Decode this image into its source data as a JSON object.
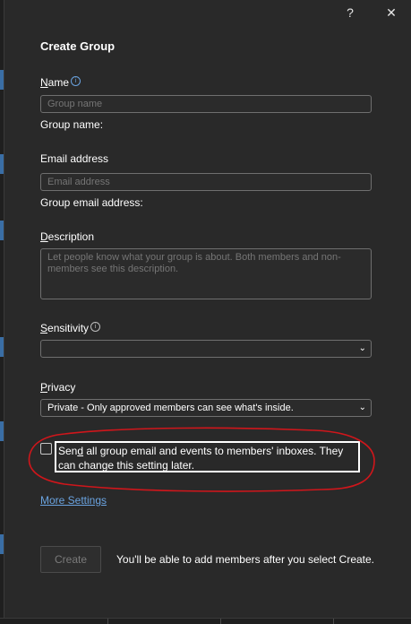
{
  "titlebar": {
    "help": "?",
    "close": "✕"
  },
  "dialog": {
    "title": "Create Group"
  },
  "name": {
    "label_first": "N",
    "label_rest": "ame",
    "placeholder": "Group name",
    "helper": "Group name:"
  },
  "email": {
    "label": "Email address",
    "placeholder": "Email address",
    "helper": "Group email address:"
  },
  "description": {
    "label_first": "D",
    "label_rest": "escription",
    "placeholder": "Let people know what your group is about. Both members and non-members see this description."
  },
  "sensitivity": {
    "label_first": "S",
    "label_rest": "ensitivity",
    "value": ""
  },
  "privacy": {
    "label_first": "P",
    "label_rest": "rivacy",
    "value": "Private - Only approved members can see what's inside."
  },
  "subscribe": {
    "checked": false,
    "label_first": "Sen",
    "label_mid": "d",
    "label_rest": " all group email and events to members' inboxes. They can change this setting later."
  },
  "more_settings": "More Settings",
  "create_button": "Create",
  "footer_note": "You'll be able to add members after you select Create.",
  "icons": {
    "info": "i",
    "chevron": "⌄"
  },
  "colors": {
    "background": "#292929",
    "link": "#6aa3e0",
    "annotation": "#d0161b"
  }
}
